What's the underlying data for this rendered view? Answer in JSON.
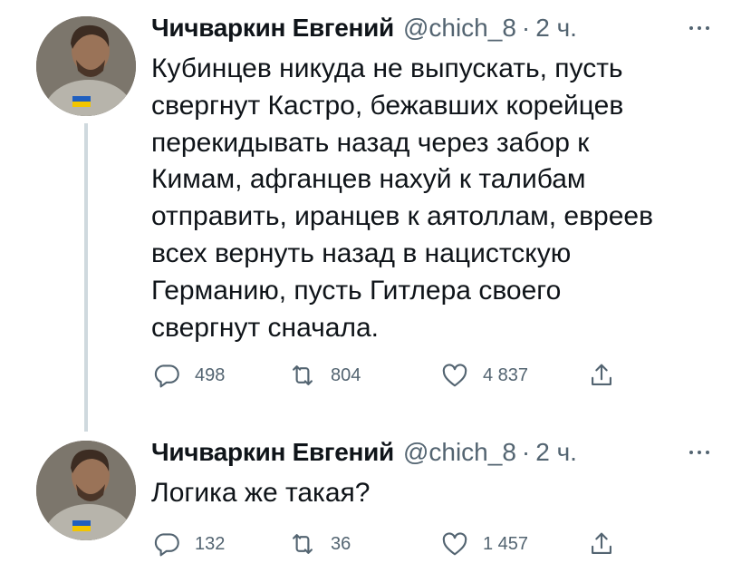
{
  "tweets": [
    {
      "author_name": "Чичваркин Евгений",
      "handle": "@chich_8",
      "separator": "·",
      "time": "2 ч.",
      "text_lines": [
        "Кубинцев никуда не выпускать, пусть",
        "свергнут Кастро, бежавших корейцев",
        "перекидывать назад через забор к",
        "Кимам, афганцев нахуй к талибам",
        "отправить, иранцев к аятоллам, евреев",
        "всех вернуть назад в нацистскую",
        "Германию, пусть Гитлера своего",
        "свергнут сначала."
      ],
      "replies": "498",
      "retweets": "804",
      "likes": "4 837"
    },
    {
      "author_name": "Чичваркин Евгений",
      "handle": "@chich_8",
      "separator": "·",
      "time": "2 ч.",
      "text_lines": [
        "Логика же такая?"
      ],
      "replies": "132",
      "retweets": "36",
      "likes": "1 457"
    }
  ],
  "icons": {
    "reply": "reply-icon",
    "retweet": "retweet-icon",
    "like": "like-icon",
    "share": "share-icon",
    "more": "more-icon"
  },
  "colors": {
    "text": "#0f1419",
    "secondary": "#536471",
    "thread_line": "#cfd9de",
    "flag_blue": "#1f5fbf",
    "flag_yellow": "#f2c500"
  }
}
